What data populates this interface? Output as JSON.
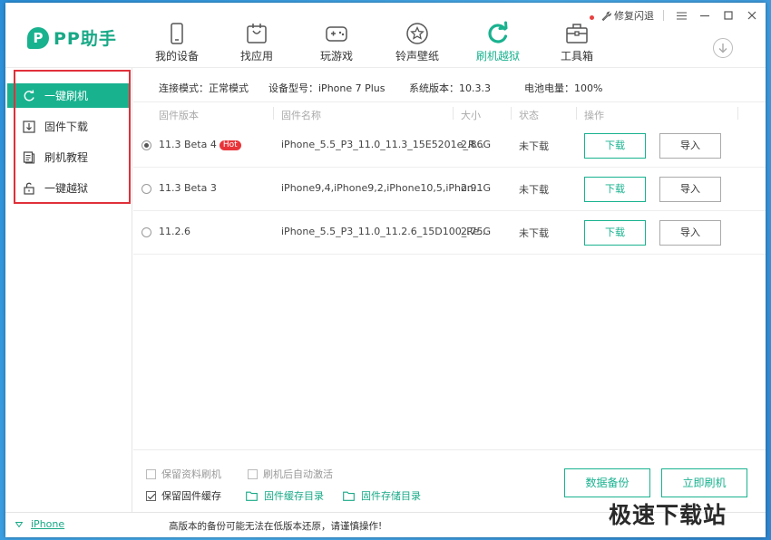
{
  "app": {
    "logo_letter": "P",
    "logo_text": "PP助手"
  },
  "nav": [
    {
      "label": "我的设备",
      "icon": "phone-icon"
    },
    {
      "label": "找应用",
      "icon": "app-bag-icon"
    },
    {
      "label": "玩游戏",
      "icon": "gamepad-icon"
    },
    {
      "label": "铃声壁纸",
      "icon": "star-icon"
    },
    {
      "label": "刷机越狱",
      "icon": "refresh-icon",
      "active": true
    },
    {
      "label": "工具箱",
      "icon": "toolbox-icon",
      "has_badge": true
    }
  ],
  "window_controls": {
    "repair_label": "修复闪退"
  },
  "sidebar": [
    {
      "label": "一键刷机",
      "icon": "refresh-circle-icon",
      "active": true
    },
    {
      "label": "固件下载",
      "icon": "download-box-icon"
    },
    {
      "label": "刷机教程",
      "icon": "document-icon"
    },
    {
      "label": "一键越狱",
      "icon": "unlock-icon"
    }
  ],
  "info": {
    "mode": "连接模式：正常模式",
    "model": "设备型号：iPhone 7 Plus",
    "sys": "系统版本：10.3.3",
    "battery": "电池电量：100%"
  },
  "table": {
    "headers": [
      "固件版本",
      "固件名称",
      "大小",
      "状态",
      "操作"
    ],
    "rows": [
      {
        "version": "11.3 Beta 4",
        "hot": "Hot",
        "name": "iPhone_5.5_P3_11.0_11.3_15E5201e_R...",
        "size": "2.86G",
        "status": "未下载",
        "download": "下载",
        "import": "导入",
        "selected": true
      },
      {
        "version": "11.3 Beta 3",
        "hot": "",
        "name": "iPhone9,4,iPhone9,2,iPhone10,5,iPhon...",
        "size": "2.91G",
        "status": "未下载",
        "download": "下载",
        "import": "导入",
        "selected": false
      },
      {
        "version": "11.2.6",
        "hot": "",
        "name": "iPhone_5.5_P3_11.0_11.2.6_15D100_Re...",
        "size": "2.75G",
        "status": "未下载",
        "download": "下载",
        "import": "导入",
        "selected": false
      }
    ]
  },
  "options": {
    "keep_data": "保留资料刷机",
    "auto_activate": "刷机后自动激活",
    "keep_cache": "保留固件缓存",
    "cache_dir": "固件缓存目录",
    "storage_dir": "固件存储目录"
  },
  "actions": {
    "backup": "数据备份",
    "flash": "立即刷机"
  },
  "status": {
    "device": "iPhone",
    "message": "高版本的备份可能无法在低版本还原，请谨慎操作!"
  },
  "watermark": "极速下载站",
  "colors": {
    "accent": "#19b28f",
    "highlight_box": "#e0303a",
    "hot_badge": "#e8353a"
  }
}
